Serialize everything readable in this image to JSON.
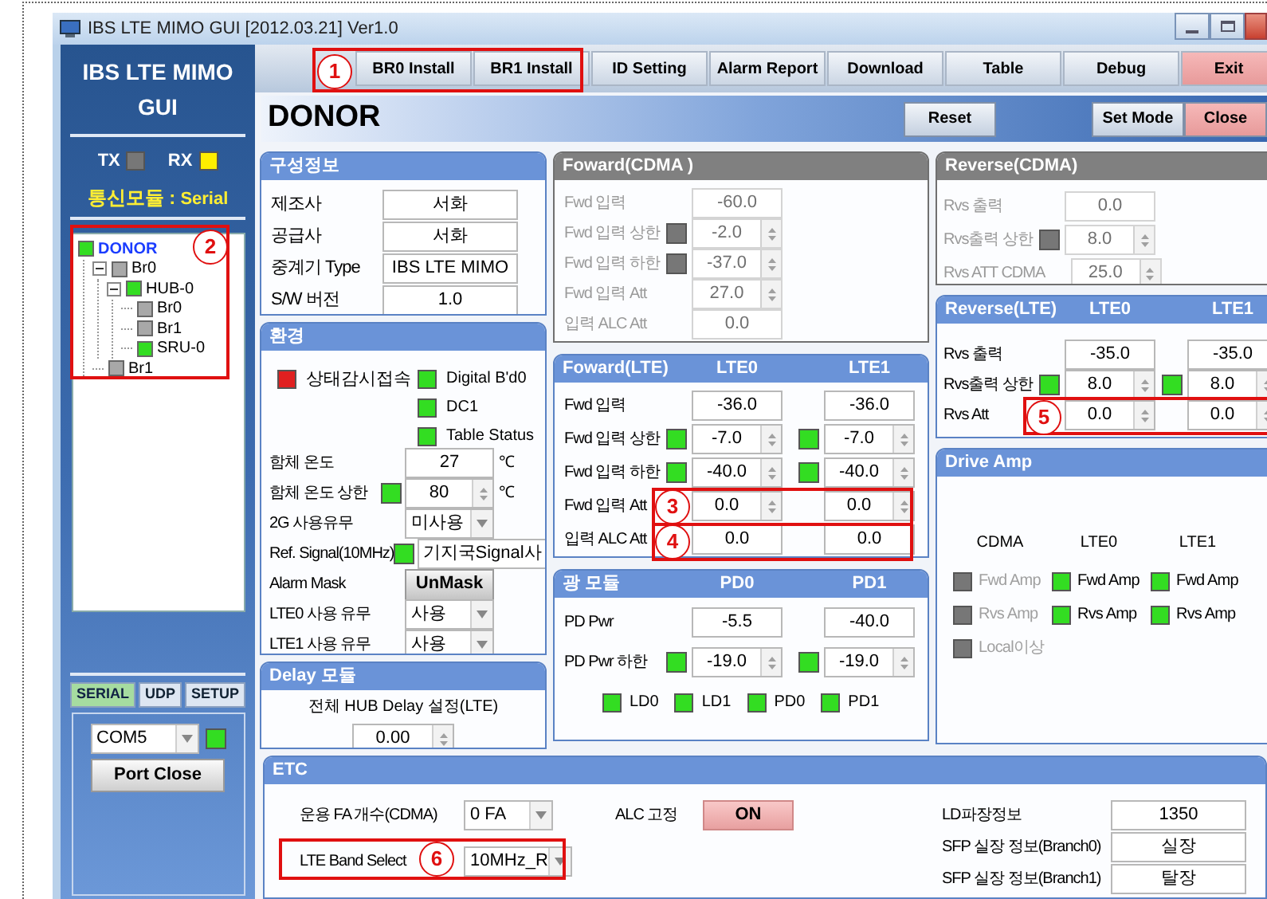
{
  "window": {
    "title": "IBS LTE MIMO GUI [2012.03.21] Ver1.0"
  },
  "sidebar": {
    "app_title": "IBS LTE MIMO GUI",
    "indicators": [
      {
        "label": "TX",
        "color": "#777777"
      },
      {
        "label": "RX",
        "color": "#ffee00"
      }
    ],
    "comm_module": {
      "label": "통신모듈 :",
      "value": "Serial"
    },
    "tree": [
      {
        "label": "DONOR",
        "selected": true,
        "color": "#33dd22",
        "children": [
          {
            "label": "Br0",
            "selected": false,
            "color": "#a8a8a8",
            "expanded": true,
            "children": [
              {
                "label": "HUB-0",
                "selected": false,
                "color": "#33dd22",
                "expanded": true,
                "children": [
                  {
                    "label": "Br0",
                    "selected": false,
                    "color": "#a8a8a8"
                  },
                  {
                    "label": "Br1",
                    "selected": false,
                    "color": "#a8a8a8"
                  },
                  {
                    "label": "SRU-0",
                    "selected": false,
                    "color": "#33dd22"
                  }
                ]
              }
            ]
          },
          {
            "label": "Br1",
            "selected": false,
            "color": "#a8a8a8"
          }
        ]
      }
    ],
    "tabs": [
      {
        "label": "SERIAL",
        "selected": true
      },
      {
        "label": "UDP",
        "selected": false
      },
      {
        "label": "SETUP",
        "selected": false
      }
    ],
    "port": {
      "value": "COM5",
      "color": "#33dd22",
      "button": "Port Close"
    }
  },
  "toolbar": [
    {
      "label": "BR0 Install",
      "kind": "normal"
    },
    {
      "label": "BR1 Install",
      "kind": "normal"
    },
    {
      "label": "ID Setting",
      "kind": "normal"
    },
    {
      "label": "Alarm Report",
      "kind": "normal"
    },
    {
      "label": "Download",
      "kind": "normal"
    },
    {
      "label": "Table",
      "kind": "normal"
    },
    {
      "label": "Debug",
      "kind": "normal"
    },
    {
      "label": "Exit",
      "kind": "danger"
    }
  ],
  "header": {
    "title": "DONOR",
    "buttons": [
      {
        "label": "Reset",
        "kind": "normal"
      },
      {
        "label": "Set Mode",
        "kind": "normal"
      },
      {
        "label": "Close",
        "kind": "danger"
      }
    ]
  },
  "config_info": {
    "title": "구성정보",
    "rows": [
      {
        "label": "제조사",
        "kind": "field",
        "cells": [
          {
            "value": "서화"
          }
        ]
      },
      {
        "label": "공급사",
        "kind": "field",
        "cells": [
          {
            "value": "서화"
          }
        ]
      },
      {
        "label": "중계기 Type",
        "kind": "field",
        "cells": [
          {
            "value": "IBS LTE MIMO"
          }
        ]
      },
      {
        "label": "S/W 버전",
        "kind": "field",
        "cells": [
          {
            "value": "1.0"
          }
        ]
      }
    ]
  },
  "environment": {
    "title": "환경",
    "alarms": [
      {
        "label": "상태감시접속",
        "color": "#e02020"
      },
      {
        "label": "Digital B'd0",
        "color": "#33dd22"
      },
      {
        "label": "DC1",
        "color": "#33dd22"
      },
      {
        "label": "Table Status",
        "color": "#33dd22"
      }
    ],
    "rows": [
      {
        "label": "함체 온도",
        "kind": "field",
        "cells": [
          {
            "value": "27"
          }
        ],
        "unit": "℃"
      },
      {
        "label": "함체 온도 상한",
        "kind": "spin",
        "cells": [
          {
            "value": "80",
            "color": "#33dd22"
          }
        ],
        "unit": "℃"
      },
      {
        "label": "2G 사용유무",
        "kind": "select",
        "cells": [
          {
            "value": "미사용"
          }
        ]
      },
      {
        "label": "Ref. Signal(10MHz)",
        "kind": "field",
        "cells": [
          {
            "value": "기지국Signal사",
            "color": "#33dd22"
          }
        ]
      },
      {
        "label": "Alarm Mask",
        "kind": "button",
        "cells": [
          {
            "value": "UnMask"
          }
        ]
      },
      {
        "label": "LTE0 사용 유무",
        "kind": "select",
        "cells": [
          {
            "value": "사용"
          }
        ]
      },
      {
        "label": "LTE1 사용 유무",
        "kind": "select",
        "cells": [
          {
            "value": "사용"
          }
        ]
      }
    ]
  },
  "delay_module": {
    "title": "Delay 모듈",
    "label": "전체 HUB Delay 설정(LTE)",
    "value": "0.00"
  },
  "forward_cdma": {
    "title": "Foward(CDMA )",
    "disabled": true,
    "rows": [
      {
        "label": "Fwd 입력",
        "kind": "field",
        "cells": [
          {
            "value": "-60.0"
          }
        ]
      },
      {
        "label": "Fwd 입력 상한",
        "kind": "spin",
        "cells": [
          {
            "value": "-2.0",
            "color": "#777777"
          }
        ]
      },
      {
        "label": "Fwd 입력 하한",
        "kind": "spin",
        "cells": [
          {
            "value": "-37.0",
            "color": "#777777"
          }
        ]
      },
      {
        "label": "Fwd 입력 Att",
        "kind": "spin",
        "cells": [
          {
            "value": "27.0"
          }
        ]
      },
      {
        "label": "입력 ALC Att",
        "kind": "field",
        "cells": [
          {
            "value": "0.0"
          }
        ]
      }
    ]
  },
  "forward_lte": {
    "title": "Foward(LTE)",
    "disabled": false,
    "columns": [
      "LTE0",
      "LTE1"
    ],
    "rows": [
      {
        "label": "Fwd 입력",
        "kind": "field",
        "cells": [
          {
            "value": "-36.0"
          },
          {
            "value": "-36.0"
          }
        ]
      },
      {
        "label": "Fwd 입력 상한",
        "kind": "spin",
        "cells": [
          {
            "value": "-7.0",
            "color": "#33dd22"
          },
          {
            "value": "-7.0",
            "color": "#33dd22"
          }
        ]
      },
      {
        "label": "Fwd 입력 하한",
        "kind": "spin",
        "cells": [
          {
            "value": "-40.0",
            "color": "#33dd22"
          },
          {
            "value": "-40.0",
            "color": "#33dd22"
          }
        ]
      },
      {
        "label": "Fwd 입력 Att",
        "kind": "spin",
        "cells": [
          {
            "value": "0.0"
          },
          {
            "value": "0.0"
          }
        ]
      },
      {
        "label": "입력 ALC Att",
        "kind": "field",
        "cells": [
          {
            "value": "0.0"
          },
          {
            "value": "0.0"
          }
        ]
      }
    ]
  },
  "optical_module": {
    "title": "광 모듈",
    "disabled": false,
    "columns": [
      "PD0",
      "PD1"
    ],
    "rows": [
      {
        "label": "PD Pwr",
        "kind": "field",
        "cells": [
          {
            "value": "-5.5"
          },
          {
            "value": "-40.0"
          }
        ]
      },
      {
        "label": "PD Pwr 하한",
        "kind": "spin",
        "cells": [
          {
            "value": "-19.0",
            "color": "#33dd22"
          },
          {
            "value": "-19.0",
            "color": "#33dd22"
          }
        ]
      }
    ],
    "status": [
      {
        "label": "LD0",
        "color": "#33dd22"
      },
      {
        "label": "LD1",
        "color": "#33dd22"
      },
      {
        "label": "PD0",
        "color": "#33dd22"
      },
      {
        "label": "PD1",
        "color": "#33dd22"
      }
    ]
  },
  "reverse_cdma": {
    "title": "Reverse(CDMA)",
    "disabled": true,
    "rows": [
      {
        "label": "Rvs 출력",
        "kind": "field",
        "cells": [
          {
            "value": "0.0"
          }
        ]
      },
      {
        "label": "Rvs출력 상한",
        "kind": "spin",
        "cells": [
          {
            "value": "8.0",
            "color": "#777777"
          }
        ]
      },
      {
        "label": "Rvs ATT CDMA",
        "kind": "spin",
        "cells": [
          {
            "value": "25.0"
          }
        ]
      }
    ]
  },
  "reverse_lte": {
    "title": "Reverse(LTE)",
    "disabled": false,
    "columns": [
      "LTE0",
      "LTE1"
    ],
    "rows": [
      {
        "label": "Rvs 출력",
        "kind": "field",
        "cells": [
          {
            "value": "-35.0"
          },
          {
            "value": "-35.0"
          }
        ]
      },
      {
        "label": "Rvs출력 상한",
        "kind": "spin",
        "cells": [
          {
            "value": "8.0",
            "color": "#33dd22"
          },
          {
            "value": "8.0",
            "color": "#33dd22"
          }
        ]
      },
      {
        "label": "Rvs Att",
        "kind": "spin",
        "cells": [
          {
            "value": "0.0"
          },
          {
            "value": "0.0"
          }
        ]
      }
    ]
  },
  "drive_amp": {
    "title": "Drive Amp",
    "columns": [
      {
        "title": "CDMA",
        "disabled": true,
        "items": [
          {
            "label": "Fwd Amp",
            "color": "#777777"
          },
          {
            "label": "Rvs Amp",
            "color": "#777777"
          },
          {
            "label": "Local이상",
            "color": "#777777"
          }
        ]
      },
      {
        "title": "LTE0",
        "disabled": false,
        "items": [
          {
            "label": "Fwd Amp",
            "color": "#33dd22"
          },
          {
            "label": "Rvs Amp",
            "color": "#33dd22"
          }
        ]
      },
      {
        "title": "LTE1",
        "disabled": false,
        "items": [
          {
            "label": "Fwd Amp",
            "color": "#33dd22"
          },
          {
            "label": "Rvs Amp",
            "color": "#33dd22"
          }
        ]
      }
    ]
  },
  "etc": {
    "title": "ETC",
    "left": [
      {
        "label": "운용 FA 개수(CDMA)",
        "kind": "select",
        "cells": [
          {
            "value": "0 FA"
          }
        ]
      },
      {
        "label": "LTE Band Select",
        "kind": "select",
        "cells": [
          {
            "value": "10MHz_R"
          }
        ]
      }
    ],
    "middle": [
      {
        "label": "ALC 고정",
        "kind": "toggle",
        "cells": [
          {
            "value": "ON"
          }
        ]
      }
    ],
    "right": [
      {
        "label": "LD파장정보",
        "kind": "field",
        "cells": [
          {
            "value": "1350"
          }
        ]
      },
      {
        "label": "SFP 실장 정보(Branch0)",
        "kind": "field",
        "cells": [
          {
            "value": "실장"
          }
        ]
      },
      {
        "label": "SFP 실장 정보(Branch1)",
        "kind": "field",
        "cells": [
          {
            "value": "탈장"
          }
        ]
      }
    ]
  },
  "annotations": [
    {
      "label": "1"
    },
    {
      "label": "2"
    },
    {
      "label": "3"
    },
    {
      "label": "4"
    },
    {
      "label": "5"
    },
    {
      "label": "6"
    }
  ]
}
